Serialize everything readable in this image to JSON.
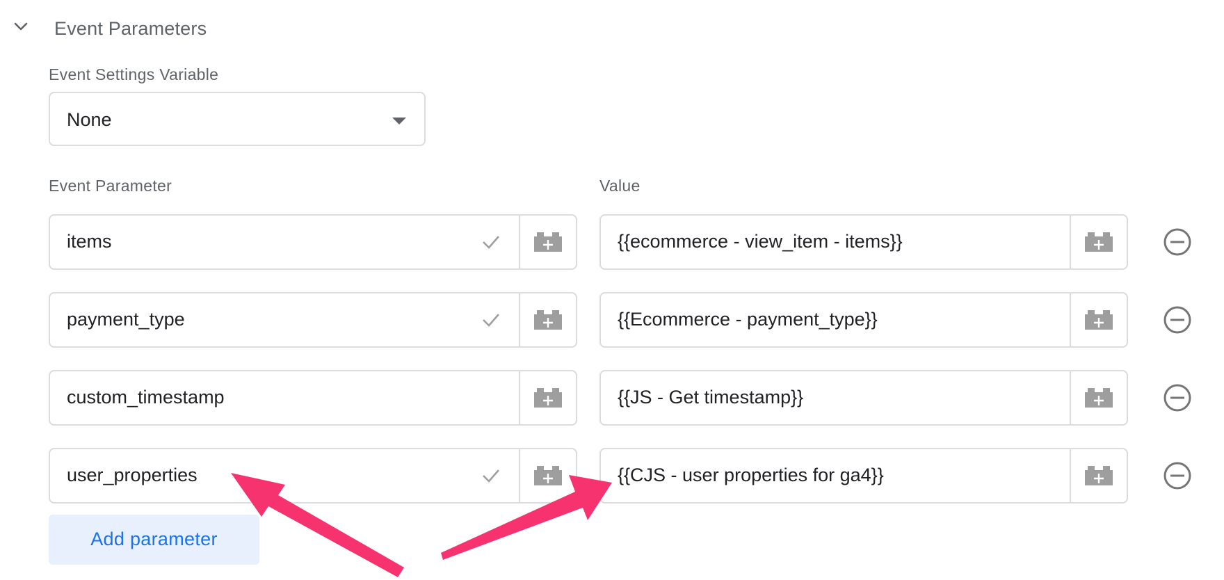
{
  "section": {
    "title": "Event Parameters",
    "expanded": true
  },
  "settings_variable": {
    "label": "Event Settings Variable",
    "value": "None"
  },
  "columns": {
    "parameter": "Event Parameter",
    "value": "Value"
  },
  "rows": [
    {
      "parameter": "items",
      "value": "{{ecommerce - view_item - items}}",
      "validated": true
    },
    {
      "parameter": "payment_type",
      "value": "{{Ecommerce - payment_type}}",
      "validated": true
    },
    {
      "parameter": "custom_timestamp",
      "value": "{{JS - Get timestamp}}",
      "validated": false
    },
    {
      "parameter": "user_properties",
      "value": "{{CJS - user properties for ga4}}",
      "validated": true
    }
  ],
  "add_button": {
    "label": "Add parameter"
  },
  "colors": {
    "accent": "#1a73e8",
    "annotation_arrow": "#f7336f",
    "border": "#dadce0",
    "icon_gray": "#9e9e9e"
  }
}
